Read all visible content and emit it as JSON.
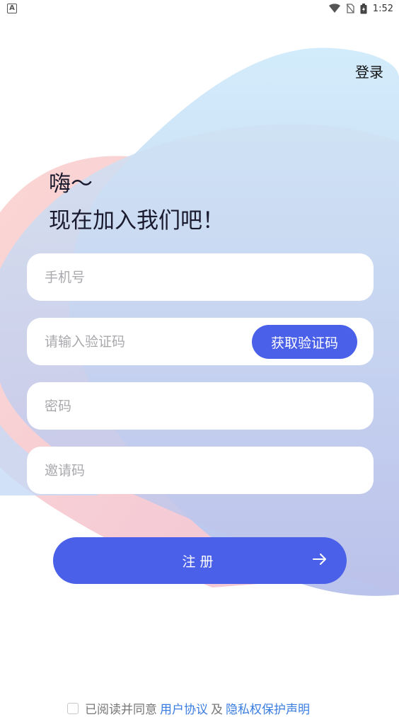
{
  "status_bar": {
    "time": "1:52",
    "notification_icon": "app-notification-icon"
  },
  "header": {
    "login_label": "登录"
  },
  "greeting": {
    "line1": "嗨～",
    "line2": "现在加入我们吧！"
  },
  "form": {
    "phone_placeholder": "手机号",
    "code_placeholder": "请输入验证码",
    "get_code_label": "获取验证码",
    "password_placeholder": "密码",
    "invite_placeholder": "邀请码"
  },
  "register": {
    "label": "注册"
  },
  "agreement": {
    "prefix": "已阅读并同意",
    "user_agreement": "用户协议",
    "conjunction": "及",
    "privacy": "隐私权保护声明"
  },
  "colors": {
    "accent": "#4a60e8",
    "link": "#3a7de0"
  }
}
